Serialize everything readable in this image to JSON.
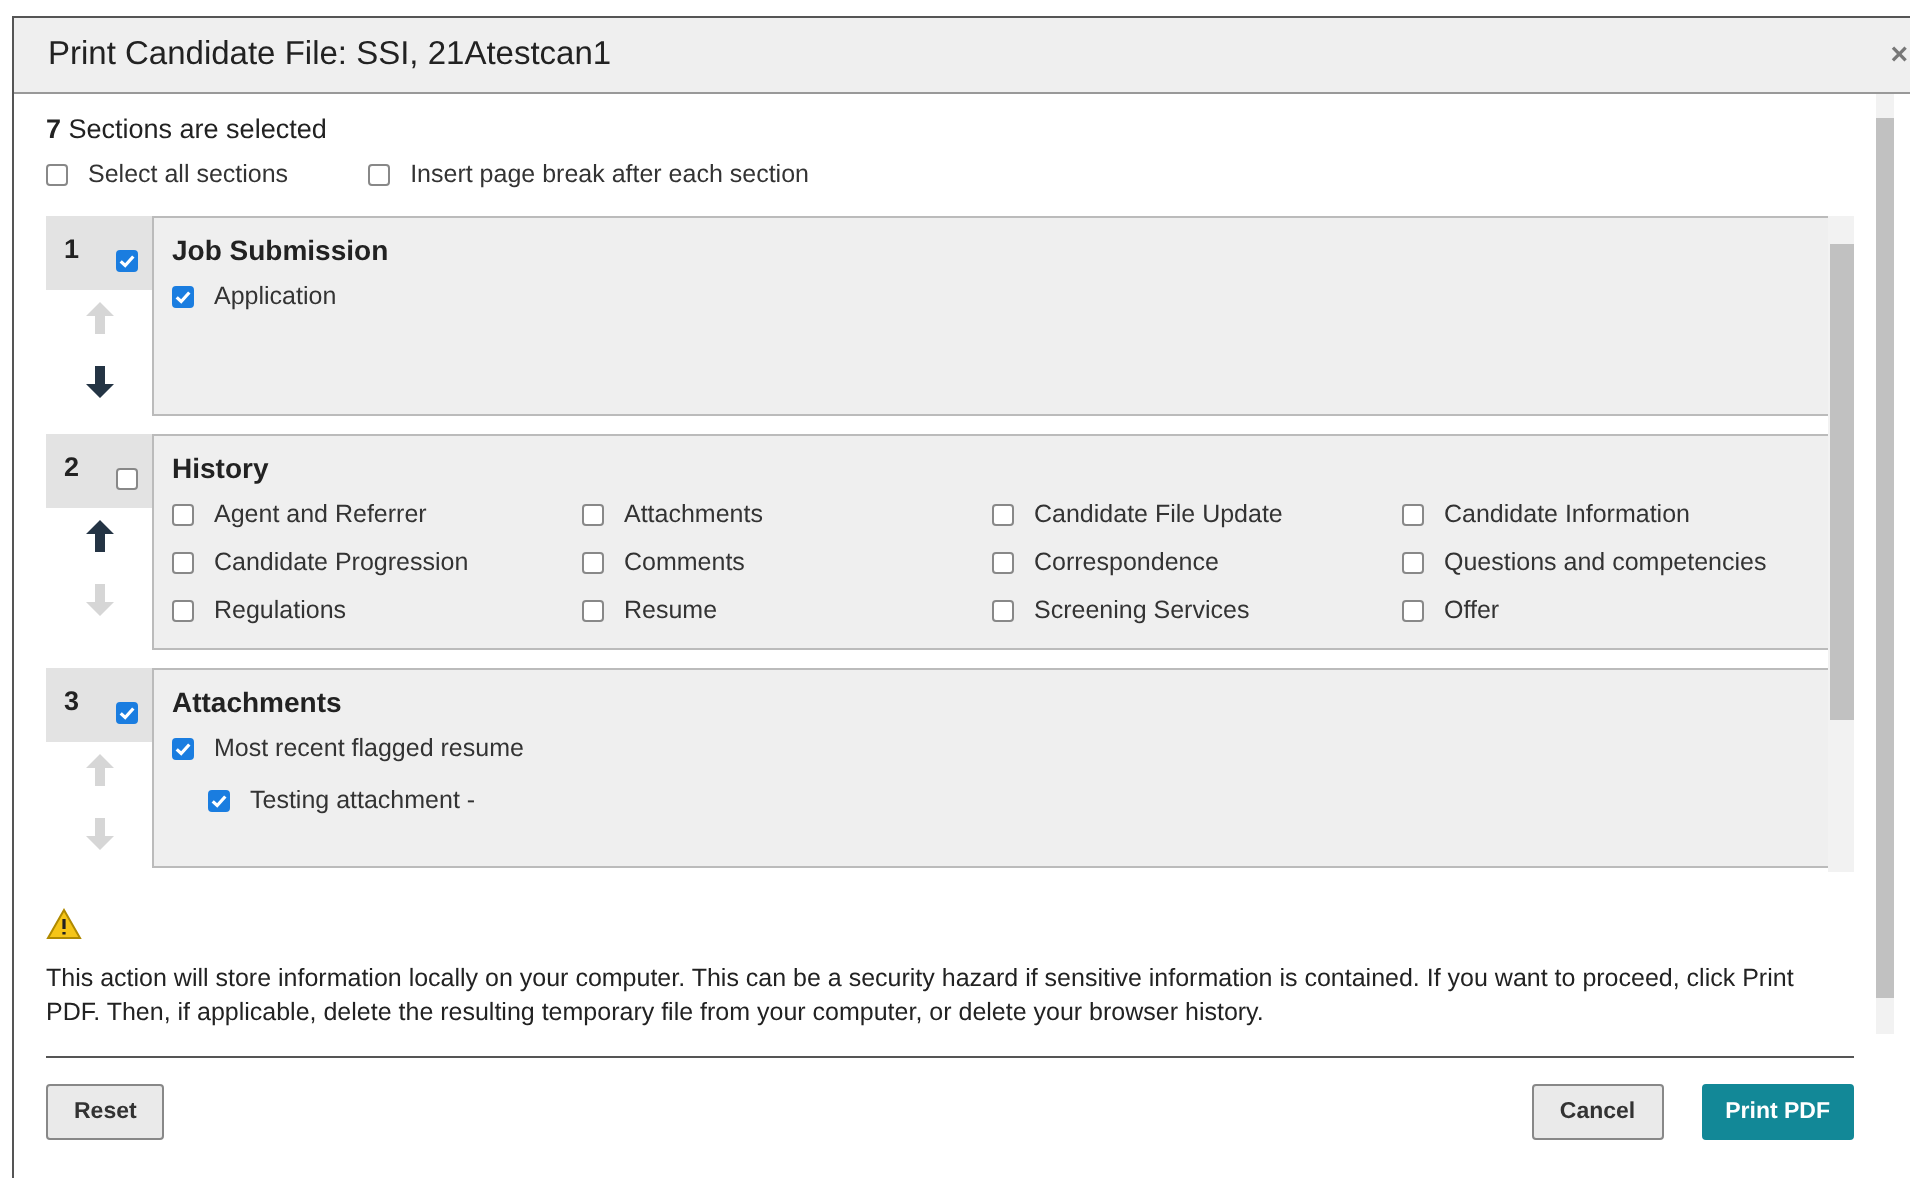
{
  "dialog": {
    "title": "Print Candidate File: SSI, 21Atestcan1",
    "close": "×"
  },
  "summary": {
    "count": "7",
    "text": "Sections are selected"
  },
  "options": [
    {
      "label": "Select all sections",
      "checked": false
    },
    {
      "label": "Insert page break after each section",
      "checked": false
    }
  ],
  "sections": [
    {
      "number": "1",
      "checked": true,
      "title": "Job Submission",
      "up_enabled": false,
      "down_enabled": true,
      "items": [
        {
          "label": "Application",
          "checked": true
        }
      ]
    },
    {
      "number": "2",
      "checked": false,
      "title": "History",
      "up_enabled": true,
      "down_enabled": false,
      "items": [
        {
          "label": "Agent and Referrer",
          "checked": false
        },
        {
          "label": "Attachments",
          "checked": false
        },
        {
          "label": "Candidate File Update",
          "checked": false
        },
        {
          "label": "Candidate Information",
          "checked": false
        },
        {
          "label": "Candidate Progression",
          "checked": false
        },
        {
          "label": "Comments",
          "checked": false
        },
        {
          "label": "Correspondence",
          "checked": false
        },
        {
          "label": "Questions and competencies",
          "checked": false
        },
        {
          "label": "Regulations",
          "checked": false
        },
        {
          "label": "Resume",
          "checked": false
        },
        {
          "label": "Screening Services",
          "checked": false
        },
        {
          "label": "Offer",
          "checked": false
        }
      ]
    },
    {
      "number": "3",
      "checked": true,
      "title": "Attachments",
      "up_enabled": false,
      "down_enabled": false,
      "items": [
        {
          "label": "Most recent flagged resume",
          "checked": true,
          "children": [
            {
              "label": "Testing attachment -",
              "checked": true
            }
          ]
        }
      ]
    }
  ],
  "warning": {
    "text": "This action will store information locally on your computer. This can be a security hazard if sensitive information is contained. If you want to proceed, click Print PDF. Then, if applicable, delete the resulting temporary file from your computer, or delete your browser history."
  },
  "buttons": [
    {
      "label": "Reset",
      "kind": "secondary"
    },
    {
      "label": "Cancel",
      "kind": "secondary"
    },
    {
      "label": "Print PDF",
      "kind": "primary"
    }
  ]
}
